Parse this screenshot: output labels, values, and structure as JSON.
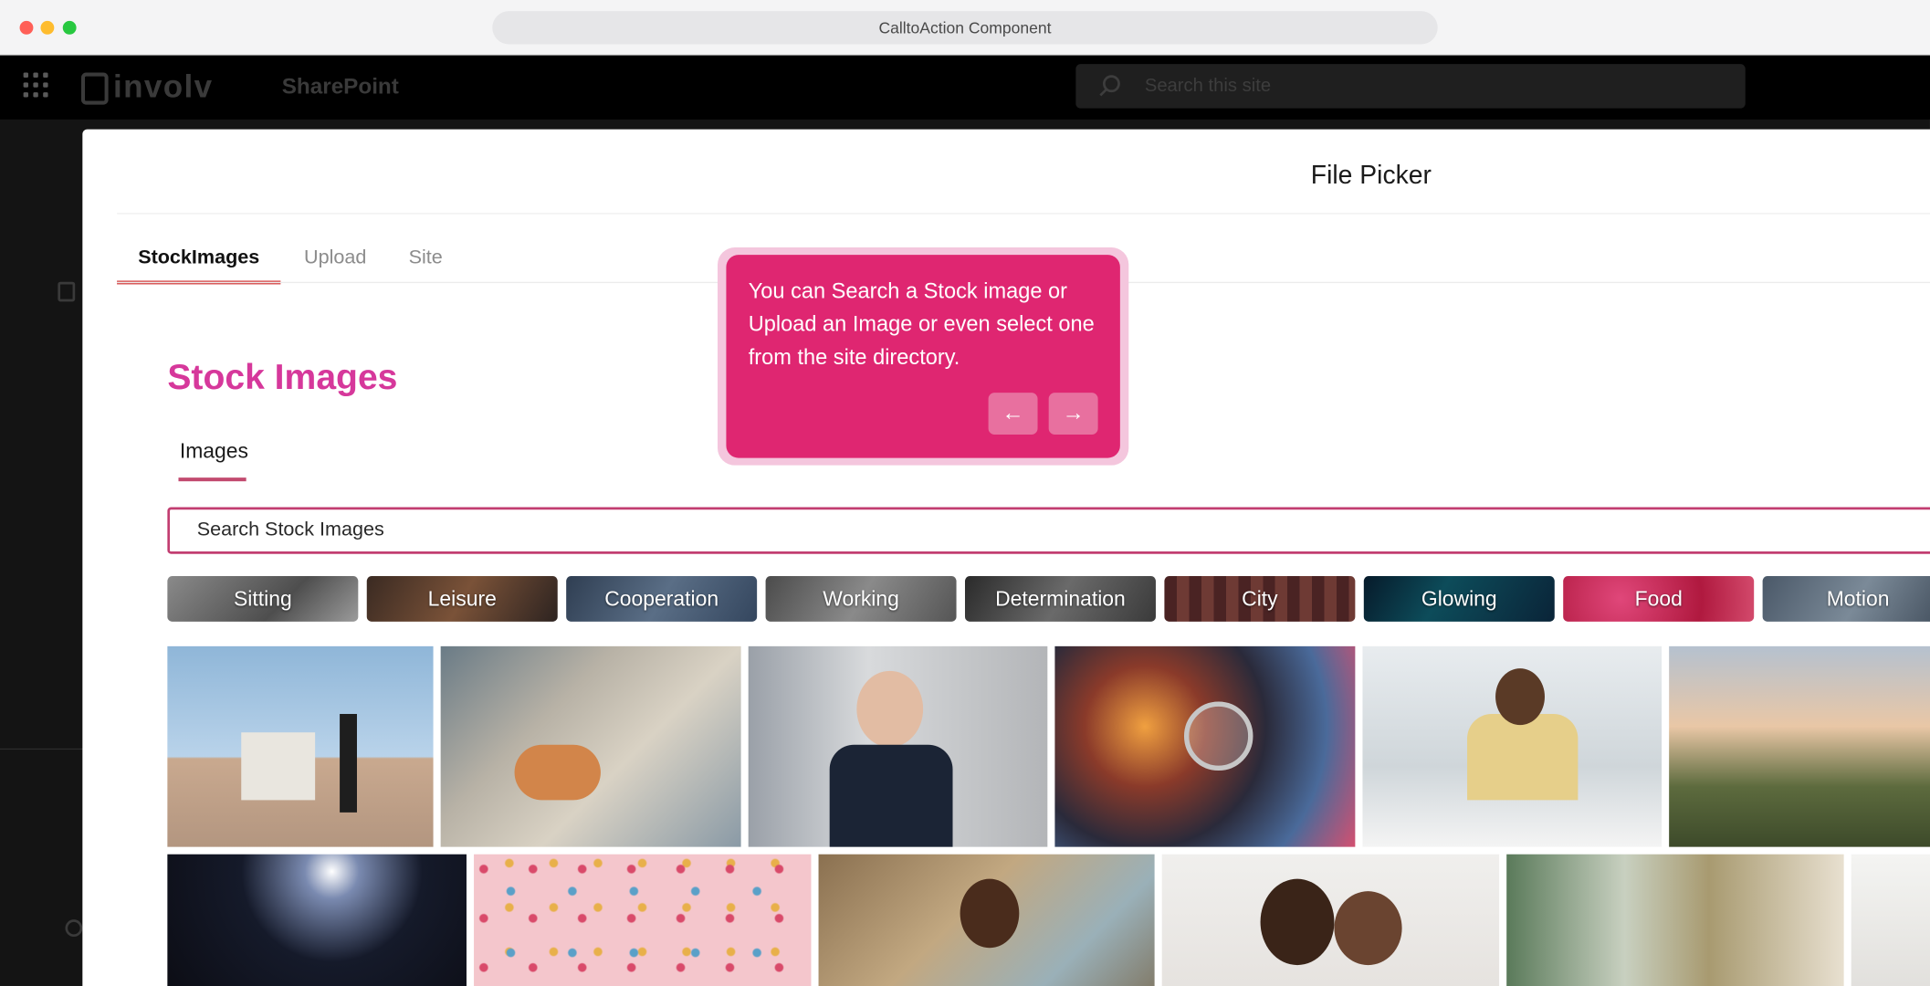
{
  "browser": {
    "title": "CalltoAction Component"
  },
  "sharepoint": {
    "logo_text": "involv",
    "site_name": "SharePoint",
    "search_placeholder": "Search this site"
  },
  "picker": {
    "title": "File Picker",
    "tabs": [
      "StockImages",
      "Upload",
      "Site"
    ],
    "section_title": "Stock Images",
    "sub_tab": "Images",
    "search_value": "Search Stock Images",
    "categories": [
      "Sitting",
      "Leisure",
      "Cooperation",
      "Working",
      "Determination",
      "City",
      "Glowing",
      "Food",
      "Motion"
    ]
  },
  "tooltip": {
    "text": "You can Search a Stock image or Upload an Image or even select one from the site directory.",
    "prev_label": "←",
    "next_label": "→"
  }
}
